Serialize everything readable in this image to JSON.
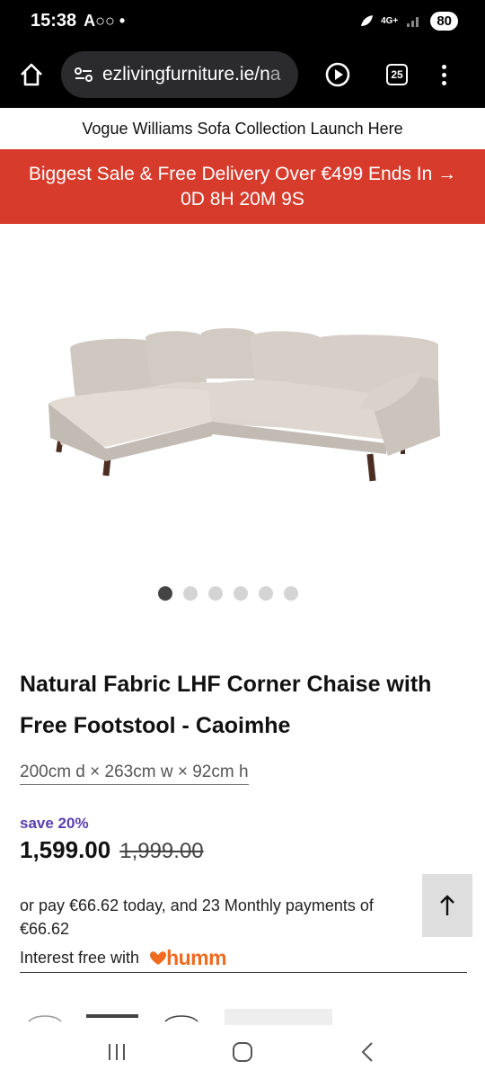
{
  "status_bar": {
    "time": "15:38",
    "left_icons": "A○○ •",
    "network": "4G+",
    "battery": "80"
  },
  "browser": {
    "url": "ezlivingfurniture.ie/n",
    "url_fade": "a",
    "tabs_count": "25"
  },
  "announcement": "Vogue Williams Sofa Collection Launch Here",
  "sale_banner": {
    "line1": "Biggest Sale & Free Delivery Over €499 Ends In →",
    "line2": "0D 8H 20M 9S",
    "color": "#d63b2c"
  },
  "gallery": {
    "image_subject": "sofa-image",
    "total_slides": 6,
    "active_slide": 1
  },
  "product": {
    "title": "Natural Fabric LHF Corner Chaise with Free Footstool - Caoimhe",
    "dimensions": "200cm d × 263cm w × 92cm h",
    "save_label": "save 20%",
    "price": "1,599.00",
    "old_price": "1,999.00",
    "accent_color": "#5a3fb0"
  },
  "finance": {
    "text": "or pay €66.62 today, and 23 Monthly payments of €66.62",
    "interest_label": "Interest free with",
    "provider": "humm",
    "provider_color": "#f06a1f"
  },
  "icons": {
    "home": "home-icon",
    "site_settings": "site-settings-icon",
    "play": "play-icon",
    "menu": "more-vert-icon",
    "back_to_top": "arrow-up-icon",
    "recents": "recents-icon",
    "home_nav": "home-nav-icon",
    "back": "back-icon"
  }
}
